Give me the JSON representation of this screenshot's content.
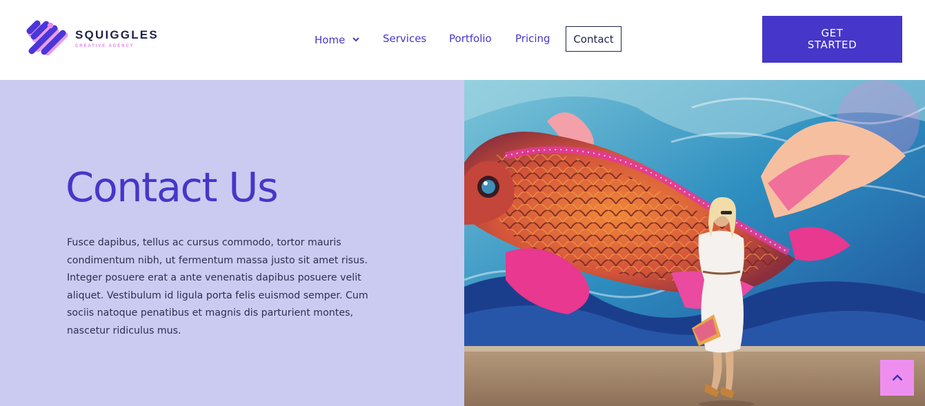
{
  "brand": {
    "name": "SQUIGGLES",
    "tagline": "CREATIVE AGENCY",
    "colors": {
      "primary": "#4636c9",
      "accent": "#ee8ff0",
      "dark": "#1f2348",
      "panel": "#cbcbf1"
    }
  },
  "nav": {
    "items": [
      {
        "label": "Home",
        "has_dropdown": true
      },
      {
        "label": "Services"
      },
      {
        "label": "Portfolio"
      },
      {
        "label": "Pricing"
      },
      {
        "label": "Contact",
        "active": true
      }
    ]
  },
  "cta": {
    "label": "GET STARTED"
  },
  "hero": {
    "title": "Contact Us",
    "body": "Fusce dapibus, tellus ac cursus commodo, tortor mauris condimentum nibh, ut fermentum massa justo sit amet risus. Integer posuere erat a ante venenatis dapibus posuere velit aliquet. Vestibulum id ligula porta felis euismod semper. Cum sociis natoque penatibus et magnis dis parturient montes, nascetur ridiculus mus."
  },
  "icons": {
    "back_to_top": "chevron-up-icon",
    "dropdown": "chevron-down-icon"
  }
}
